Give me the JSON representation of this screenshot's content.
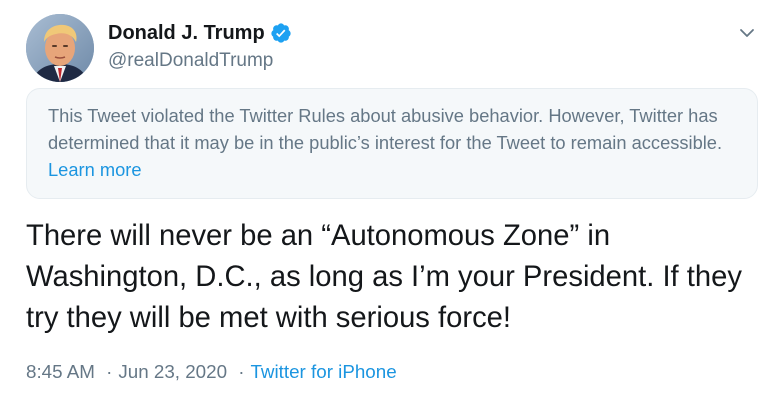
{
  "user": {
    "display_name": "Donald J. Trump",
    "handle": "@realDonaldTrump",
    "verified": true
  },
  "notice": {
    "text": "This Tweet violated the Twitter Rules about abusive behavior. However, Twitter has determined that it may be in the public’s interest for the Tweet to remain accessible.",
    "link_label": "Learn more"
  },
  "tweet": {
    "text": "There will never be an “Autonomous Zone” in Washington, D.C., as long as I’m your President. If they try they will be met with serious force!"
  },
  "meta": {
    "time": "8:45 AM",
    "separator": "·",
    "date": "Jun 23, 2020",
    "source": "Twitter for iPhone"
  },
  "colors": {
    "accent": "#1b95e0",
    "secondary_text": "#657786",
    "primary_text": "#14171a",
    "notice_bg": "#f5f8fa"
  },
  "icons": {
    "verified": "verified-badge-icon",
    "menu": "chevron-down-icon"
  }
}
